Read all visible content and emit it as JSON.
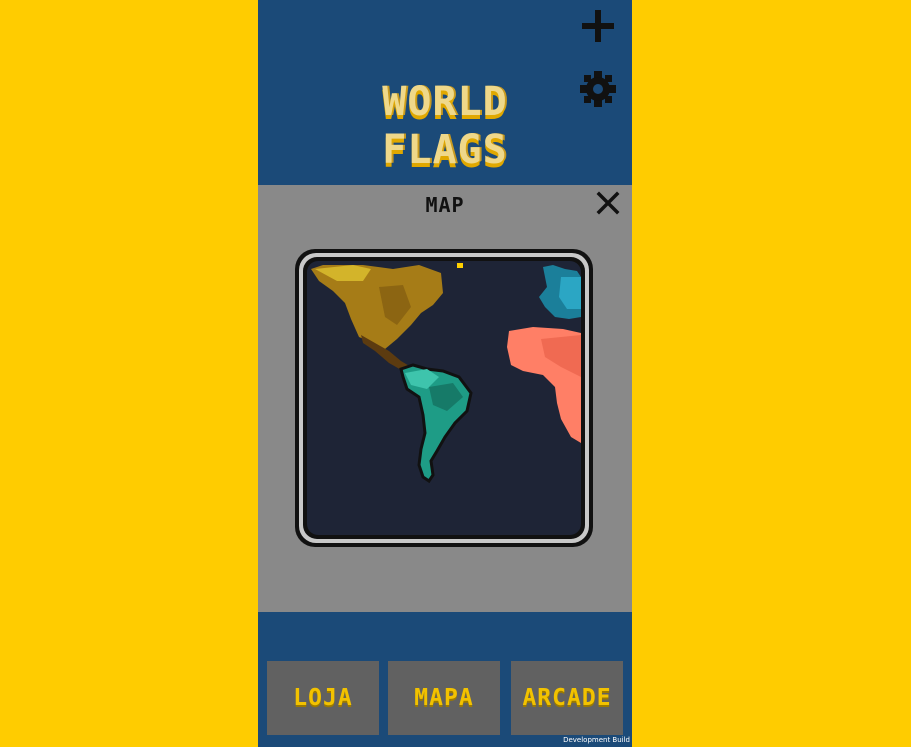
{
  "header": {
    "title_line1": "WORLD",
    "title_line2": "FLAGS",
    "add_icon": "plus-icon",
    "settings_icon": "gear-icon"
  },
  "map_panel": {
    "title": "MAP",
    "close_icon": "close-icon",
    "continents": [
      {
        "name": "north-america",
        "color": "#A67C17"
      },
      {
        "name": "south-america",
        "color": "#1E9C86"
      },
      {
        "name": "africa",
        "color": "#FF7F66"
      },
      {
        "name": "europe",
        "color": "#1B7F9A"
      }
    ],
    "map_background": "#1E2436"
  },
  "bottom_nav": {
    "shop_label": "LOJA",
    "map_label": "MAPA",
    "arcade_label": "ARCADE"
  },
  "footer": {
    "dev_build": "Development Build"
  },
  "colors": {
    "page_background": "#FFCC00",
    "game_background": "#1B4A78",
    "panel_background": "#898989",
    "button_background": "#616161",
    "button_text": "#F2C200"
  }
}
